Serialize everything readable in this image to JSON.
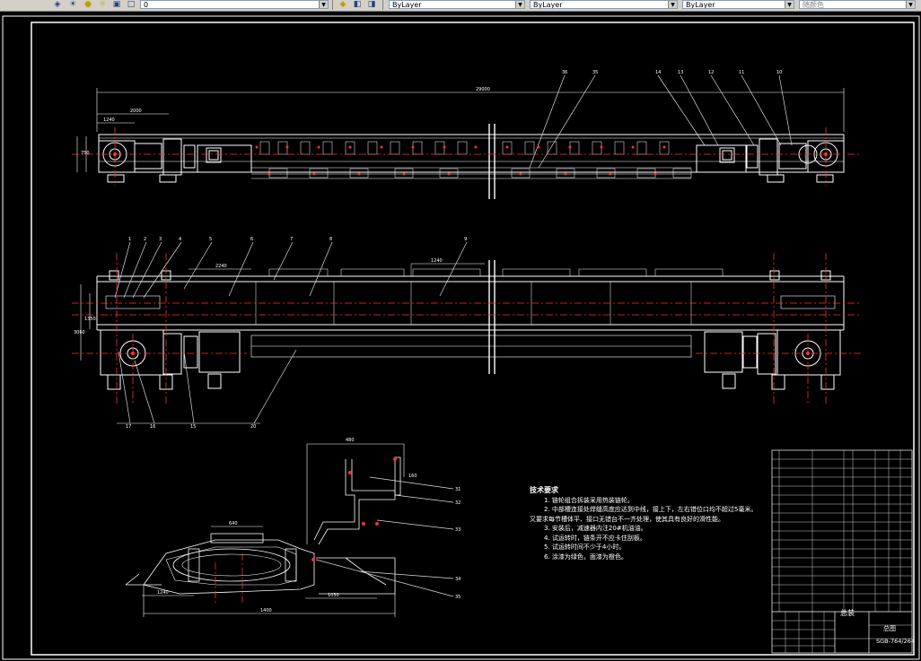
{
  "toolbar": {
    "layer_value": "0",
    "color_value": "ByLayer",
    "linetype_value": "ByLayer",
    "lineweight_value": "ByLayer",
    "plotstyle_value": "随颜色"
  },
  "dimensions": {
    "overall_top": "29000",
    "top_left_a": "2000",
    "top_left_b": "1240",
    "top_left_h": "750",
    "plan_a": "2240",
    "plan_b": "1240",
    "plan_h1": "3060",
    "plan_h2": "1350",
    "section_top": "480",
    "section_side": "160",
    "section_mid": "640",
    "section_left": "1240",
    "section_right": "1050",
    "section_bottom": "1400"
  },
  "callouts": {
    "top": [
      "36",
      "35",
      "14",
      "13",
      "12",
      "11",
      "10"
    ],
    "plan_top": [
      "1",
      "2",
      "3",
      "4",
      "5",
      "6",
      "7",
      "8",
      "9"
    ],
    "plan_bottom": [
      "17",
      "16",
      "15",
      "20"
    ],
    "section": [
      "31",
      "32",
      "33",
      "34",
      "35"
    ]
  },
  "notes": {
    "title": "技术要求",
    "lines": [
      "1. 链轮组合拆装采用热装链轮。",
      "2. 中部槽连接处焊缝高度应达到中线，接上下，左右错位口均不超过5毫米。",
      "又要求每节槽体平、接口无错台不一齐处理，使其具有良好的滑性能。",
      "3. 安装后，减速器内注20#机油油。",
      "4. 试运转时，链条开不应卡住刮板。",
      "5. 试运转时间不少于4小时。",
      "6. 涂漆为绿色，面漆为橙色。"
    ]
  },
  "title_block": {
    "drawing_label": "总装",
    "drawing_name": "总图",
    "drawing_code": "SGB-764/264"
  },
  "colors": {
    "line": "#ffffff",
    "center": "#ff3030",
    "leader": "#e0e0e0",
    "toolbar": "#d4d0c8"
  }
}
